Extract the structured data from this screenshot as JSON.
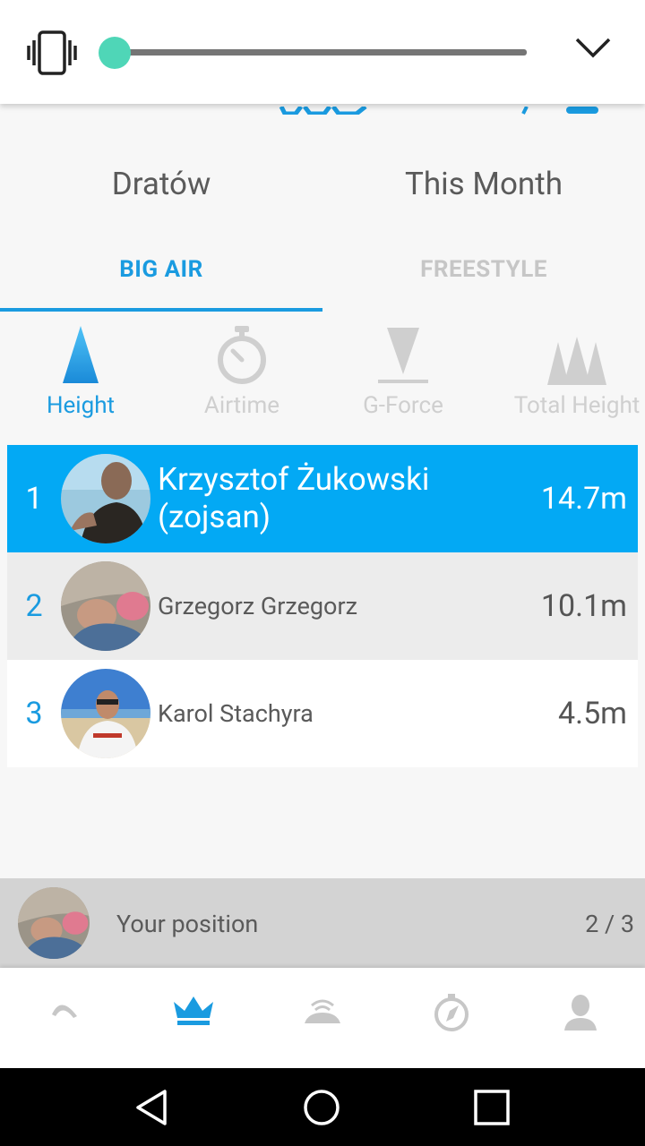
{
  "filters": {
    "location": "Dratów",
    "period": "This Month"
  },
  "tabs": [
    {
      "label": "BIG AIR",
      "active": true
    },
    {
      "label": "FREESTYLE",
      "active": false
    }
  ],
  "metrics": [
    {
      "label": "Height",
      "icon": "triangle-height-icon",
      "active": true
    },
    {
      "label": "Airtime",
      "icon": "stopwatch-icon",
      "active": false
    },
    {
      "label": "G-Force",
      "icon": "g-force-icon",
      "active": false
    },
    {
      "label": "Total Height",
      "icon": "mountains-icon",
      "active": false
    }
  ],
  "leaderboard": [
    {
      "rank": "1",
      "name": "Krzysztof Żukowski (zojsan)",
      "value": "14.7m"
    },
    {
      "rank": "2",
      "name": "Grzegorz Grzegorz",
      "value": "10.1m"
    },
    {
      "rank": "3",
      "name": "Karol Stachyra",
      "value": "4.5m"
    }
  ],
  "your_position": {
    "label": "Your position",
    "value": "2 / 3"
  },
  "volume": {
    "level": 0.0,
    "accent": "#4fd6b7"
  },
  "bottom_nav": [
    {
      "icon": "session-icon",
      "active": false
    },
    {
      "icon": "crown-icon",
      "active": true
    },
    {
      "icon": "kite-sensor-icon",
      "active": false
    },
    {
      "icon": "compass-icon",
      "active": false
    },
    {
      "icon": "profile-icon",
      "active": false
    }
  ],
  "colors": {
    "accent": "#1a9be0",
    "highlight_row": "#03a9f4"
  }
}
